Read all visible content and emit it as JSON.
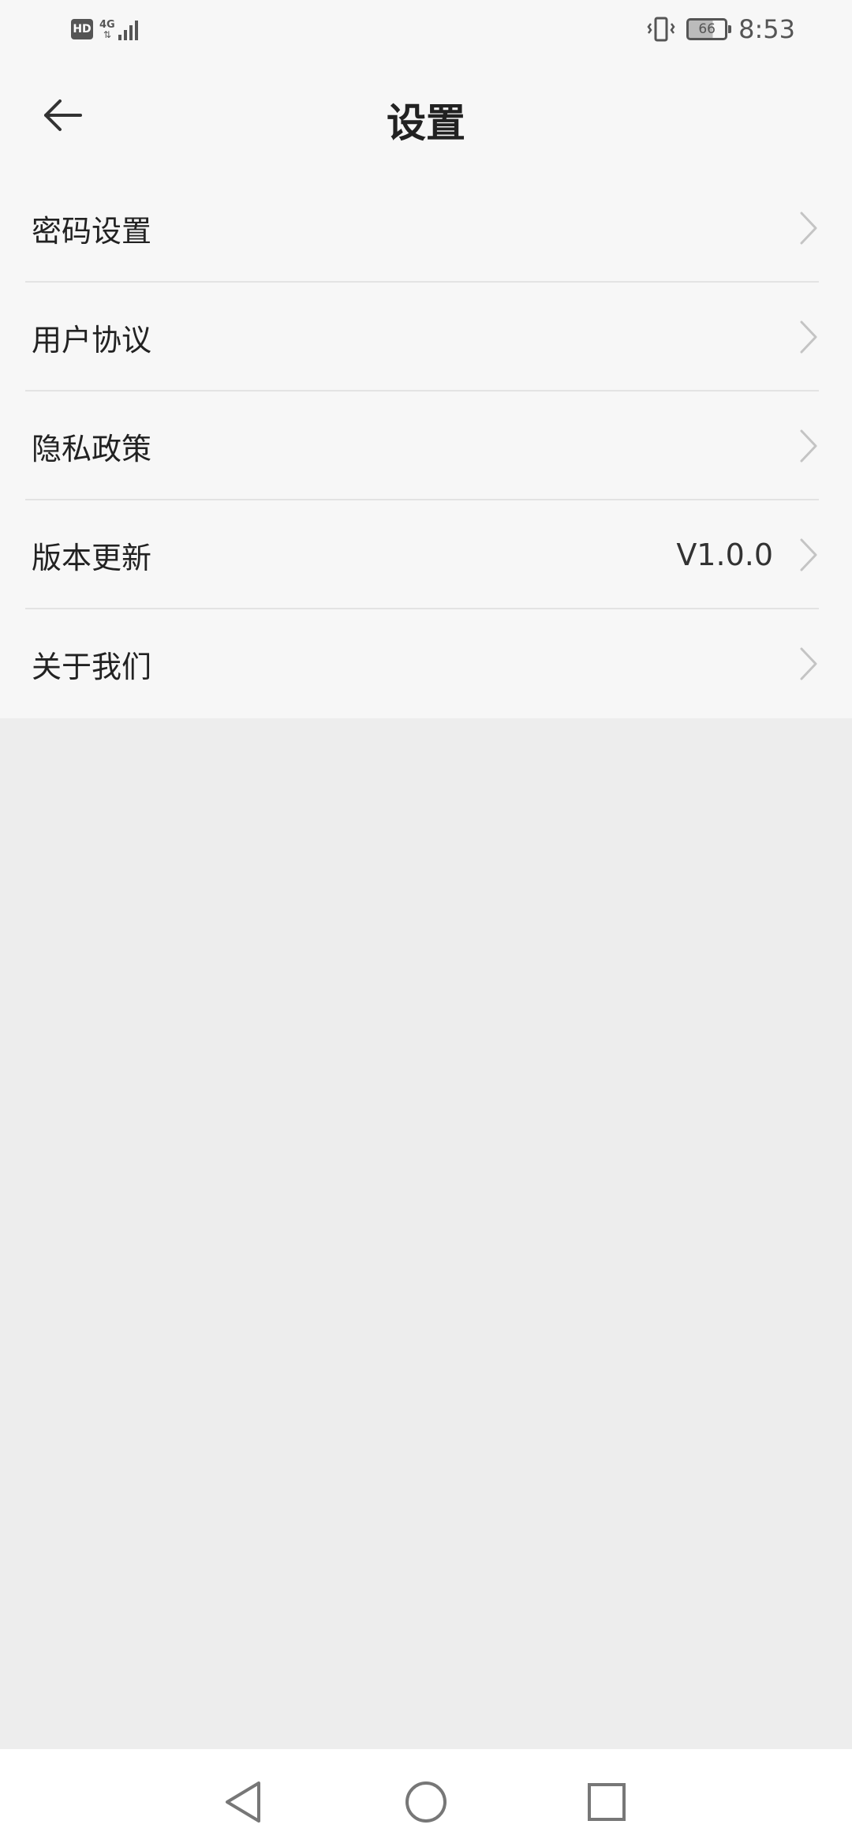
{
  "status_bar": {
    "hd_label": "HD",
    "network_label": "4G",
    "battery_level": "66",
    "time": "8:53"
  },
  "header": {
    "title": "设置",
    "back_icon": "arrow-left-icon"
  },
  "settings": {
    "items": [
      {
        "label": "密码设置",
        "value": ""
      },
      {
        "label": "用户协议",
        "value": ""
      },
      {
        "label": "隐私政策",
        "value": ""
      },
      {
        "label": "版本更新",
        "value": "V1.0.0"
      },
      {
        "label": "关于我们",
        "value": ""
      }
    ]
  },
  "nav_bar": {
    "back_icon": "triangle-back-icon",
    "home_icon": "circle-home-icon",
    "recents_icon": "square-recents-icon"
  },
  "colors": {
    "surface": "#f7f7f7",
    "background": "#ededed",
    "text_primary": "#222222",
    "chevron": "#c4c4c4",
    "divider": "#e3e3e3"
  }
}
